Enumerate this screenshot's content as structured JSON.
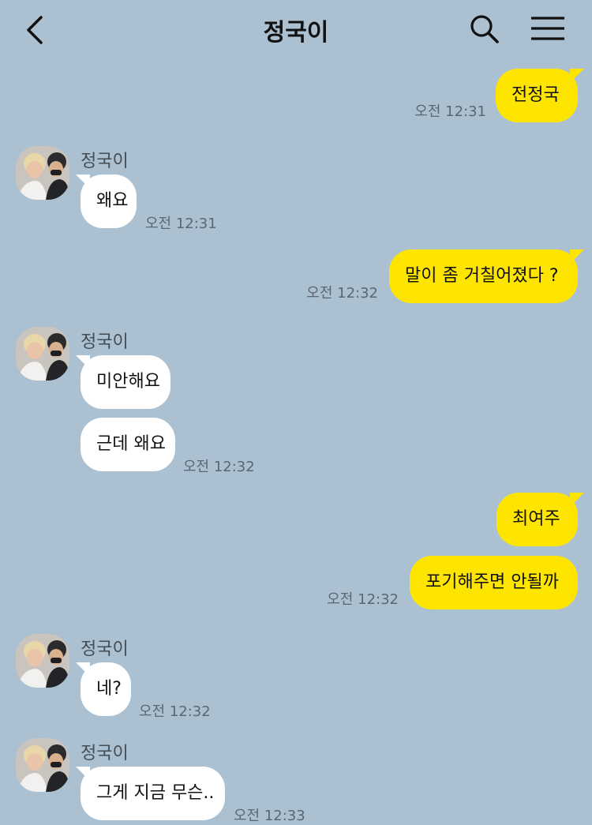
{
  "header": {
    "title": "정국이"
  },
  "messages": {
    "m1": {
      "text": "전정국",
      "time": "오전 12:31"
    },
    "m2": {
      "sender": "정국이",
      "text": "왜요",
      "time": "오전 12:31"
    },
    "m3": {
      "text": "말이 좀 거칠어졌다 ?",
      "time": "오전 12:32"
    },
    "m4": {
      "sender": "정국이",
      "text": "미안해요"
    },
    "m5": {
      "text": "근데 왜요",
      "time": "오전 12:32"
    },
    "m6": {
      "text": "최여주"
    },
    "m7": {
      "text": "포기해주면 안될까",
      "time": "오전 12:32"
    },
    "m8": {
      "sender": "정국이",
      "text": "네?",
      "time": "오전 12:32"
    },
    "m9": {
      "sender": "정국이",
      "text": "그게 지금 무슨..",
      "time": "오전 12:33"
    }
  },
  "colors": {
    "background": "#abc1d1",
    "outgoing_bubble": "#fee500",
    "incoming_bubble": "#ffffff"
  },
  "icons": {
    "back": "back-arrow-icon",
    "search": "search-icon",
    "menu": "hamburger-menu-icon",
    "avatar": "profile-photo"
  }
}
